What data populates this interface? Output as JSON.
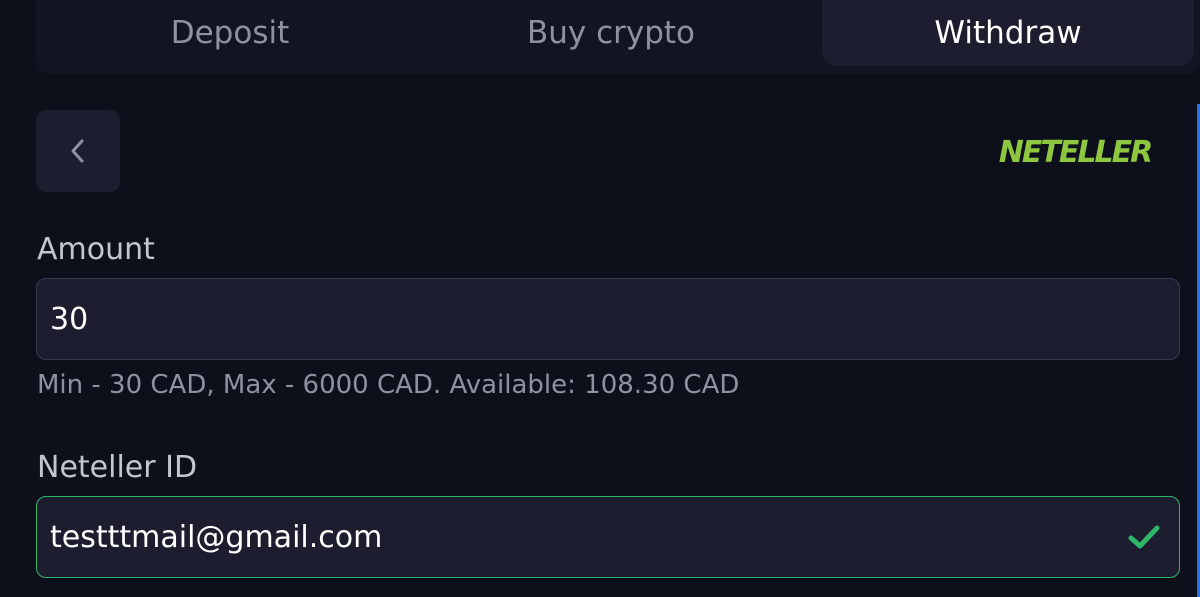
{
  "tabs": {
    "deposit": "Deposit",
    "buy_crypto": "Buy crypto",
    "withdraw": "Withdraw",
    "active": "withdraw"
  },
  "back_button": {
    "icon": "chevron-left-icon"
  },
  "provider": {
    "logo_text": "NETELLER",
    "logo_color": "#8dc63f"
  },
  "amount": {
    "label": "Amount",
    "value": "30",
    "hint": "Min - 30 CAD, Max - 6000 CAD. Available: 108.30 CAD"
  },
  "neteller_id": {
    "label": "Neteller ID",
    "value": "testttmail@gmail.com",
    "valid": true,
    "status_icon": "check-icon",
    "valid_color": "#2fb56a"
  },
  "colors": {
    "background": "#0d0f1a",
    "panel": "#1c1e30",
    "scrollbar": "#2f6fe0"
  }
}
